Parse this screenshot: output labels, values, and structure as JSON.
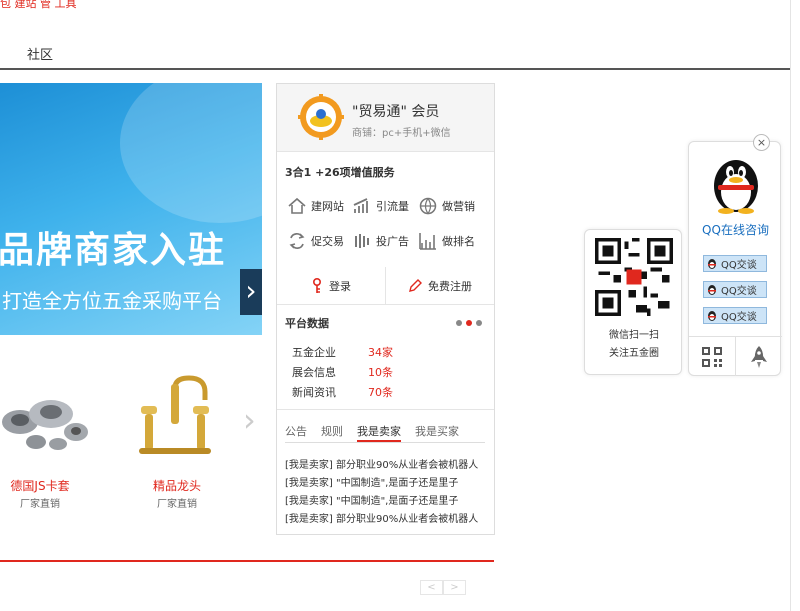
{
  "toplinks": {
    "text": "包 建站 管 工具"
  },
  "nav": {
    "items": [
      {
        "label": "社区"
      }
    ]
  },
  "banner": {
    "title": "品牌商家入驻",
    "subtitle": "打造全方位五金采购平台",
    "next_arrow": "›",
    "pages": [
      "1",
      "2",
      "3"
    ],
    "active_page": 3
  },
  "products": [
    {
      "name": "德国JS卡套",
      "sub": "厂家直销"
    },
    {
      "name": "精品龙头",
      "sub": "厂家直销"
    }
  ],
  "products_next": "›",
  "pager_small": {
    "prev": "<",
    "next": ">"
  },
  "member": {
    "title": "\"贸易通\" 会员",
    "subtitle": "商铺：pc+手机+微信",
    "services_title": "3合1 +26项增值服务",
    "services": [
      {
        "label": "建网站",
        "icon": "house-icon"
      },
      {
        "label": "引流量",
        "icon": "bar-growth-icon"
      },
      {
        "label": "做营销",
        "icon": "globe-icon"
      },
      {
        "label": "促交易",
        "icon": "exchange-icon"
      },
      {
        "label": "投广告",
        "icon": "ad-bars-icon"
      },
      {
        "label": "做排名",
        "icon": "ranking-icon"
      }
    ],
    "login": "登录",
    "register": "免费注册"
  },
  "stats": {
    "title": "平台数据",
    "rows": [
      {
        "label": "五金企业",
        "value": "34家"
      },
      {
        "label": "展会信息",
        "value": "10条"
      },
      {
        "label": "新闻资讯",
        "value": "70条"
      }
    ]
  },
  "notice": {
    "tabs": [
      "公告",
      "规则",
      "我是卖家",
      "我是买家"
    ],
    "active_tab": "我是卖家",
    "items": [
      "[我是卖家] 部分职业90%从业者会被机器人",
      "[我是卖家] \"中国制造\",是面子还是里子",
      "[我是卖家] \"中国制造\",是面子还是里子",
      "[我是卖家] 部分职业90%从业者会被机器人"
    ]
  },
  "qr": {
    "line1": "微信扫一扫",
    "line2": "关注五金圈"
  },
  "qq": {
    "close": "×",
    "title": "QQ在线咨询",
    "buttons": [
      "QQ交谈",
      "QQ交谈",
      "QQ交谈"
    ]
  },
  "colors": {
    "accent": "#e0281e",
    "link": "#1a6fbf",
    "banner": "#2ea3e6",
    "pager_active": "#e06e2c"
  }
}
